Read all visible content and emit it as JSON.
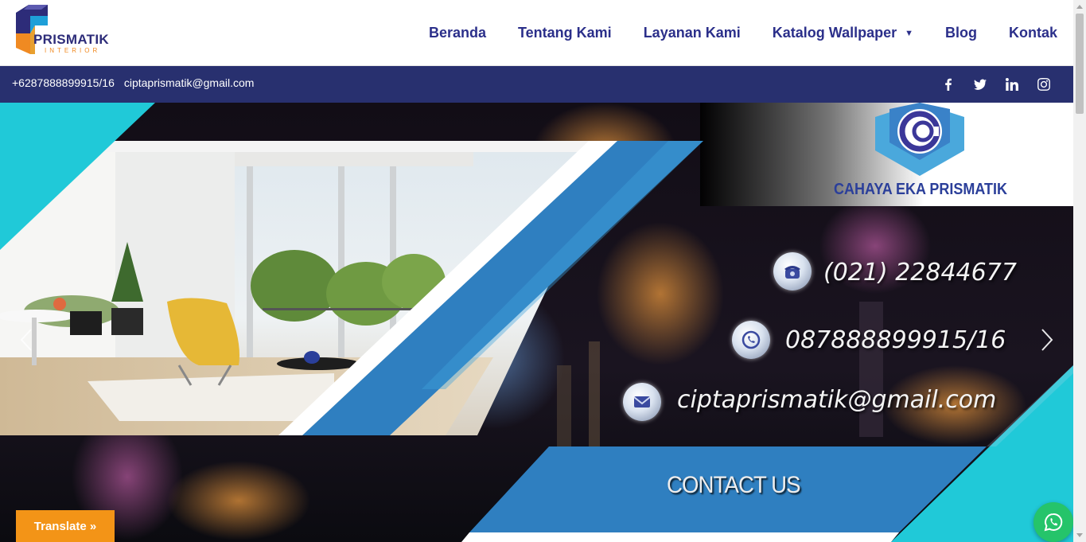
{
  "brand": {
    "name": "PRISMATIK",
    "tagline": "INTERIOR"
  },
  "nav": {
    "items": [
      {
        "label": "Beranda"
      },
      {
        "label": "Tentang Kami"
      },
      {
        "label": "Layanan Kami"
      },
      {
        "label": "Katalog Wallpaper",
        "has_dropdown": true
      },
      {
        "label": "Blog"
      },
      {
        "label": "Kontak"
      }
    ]
  },
  "topbar": {
    "phone": "+6287888899915/16",
    "email": "ciptaprismatik@gmail.com",
    "socials": [
      "facebook-icon",
      "twitter-icon",
      "linkedin-icon",
      "instagram-icon"
    ]
  },
  "hero": {
    "company": "CAHAYA EKA PRISMATIK",
    "phone": "(021) 22844677",
    "whatsapp": "087888899915/16",
    "email": "ciptaprismatik@gmail.com",
    "cta": "CONTACT US"
  },
  "widgets": {
    "translate_label": "Translate »"
  },
  "colors": {
    "navy": "#28306f",
    "nav_text": "#2b2f8a",
    "cyan": "#20c9d8",
    "blue": "#2f7fc0",
    "orange": "#f39417",
    "whatsapp": "#25c46a"
  }
}
